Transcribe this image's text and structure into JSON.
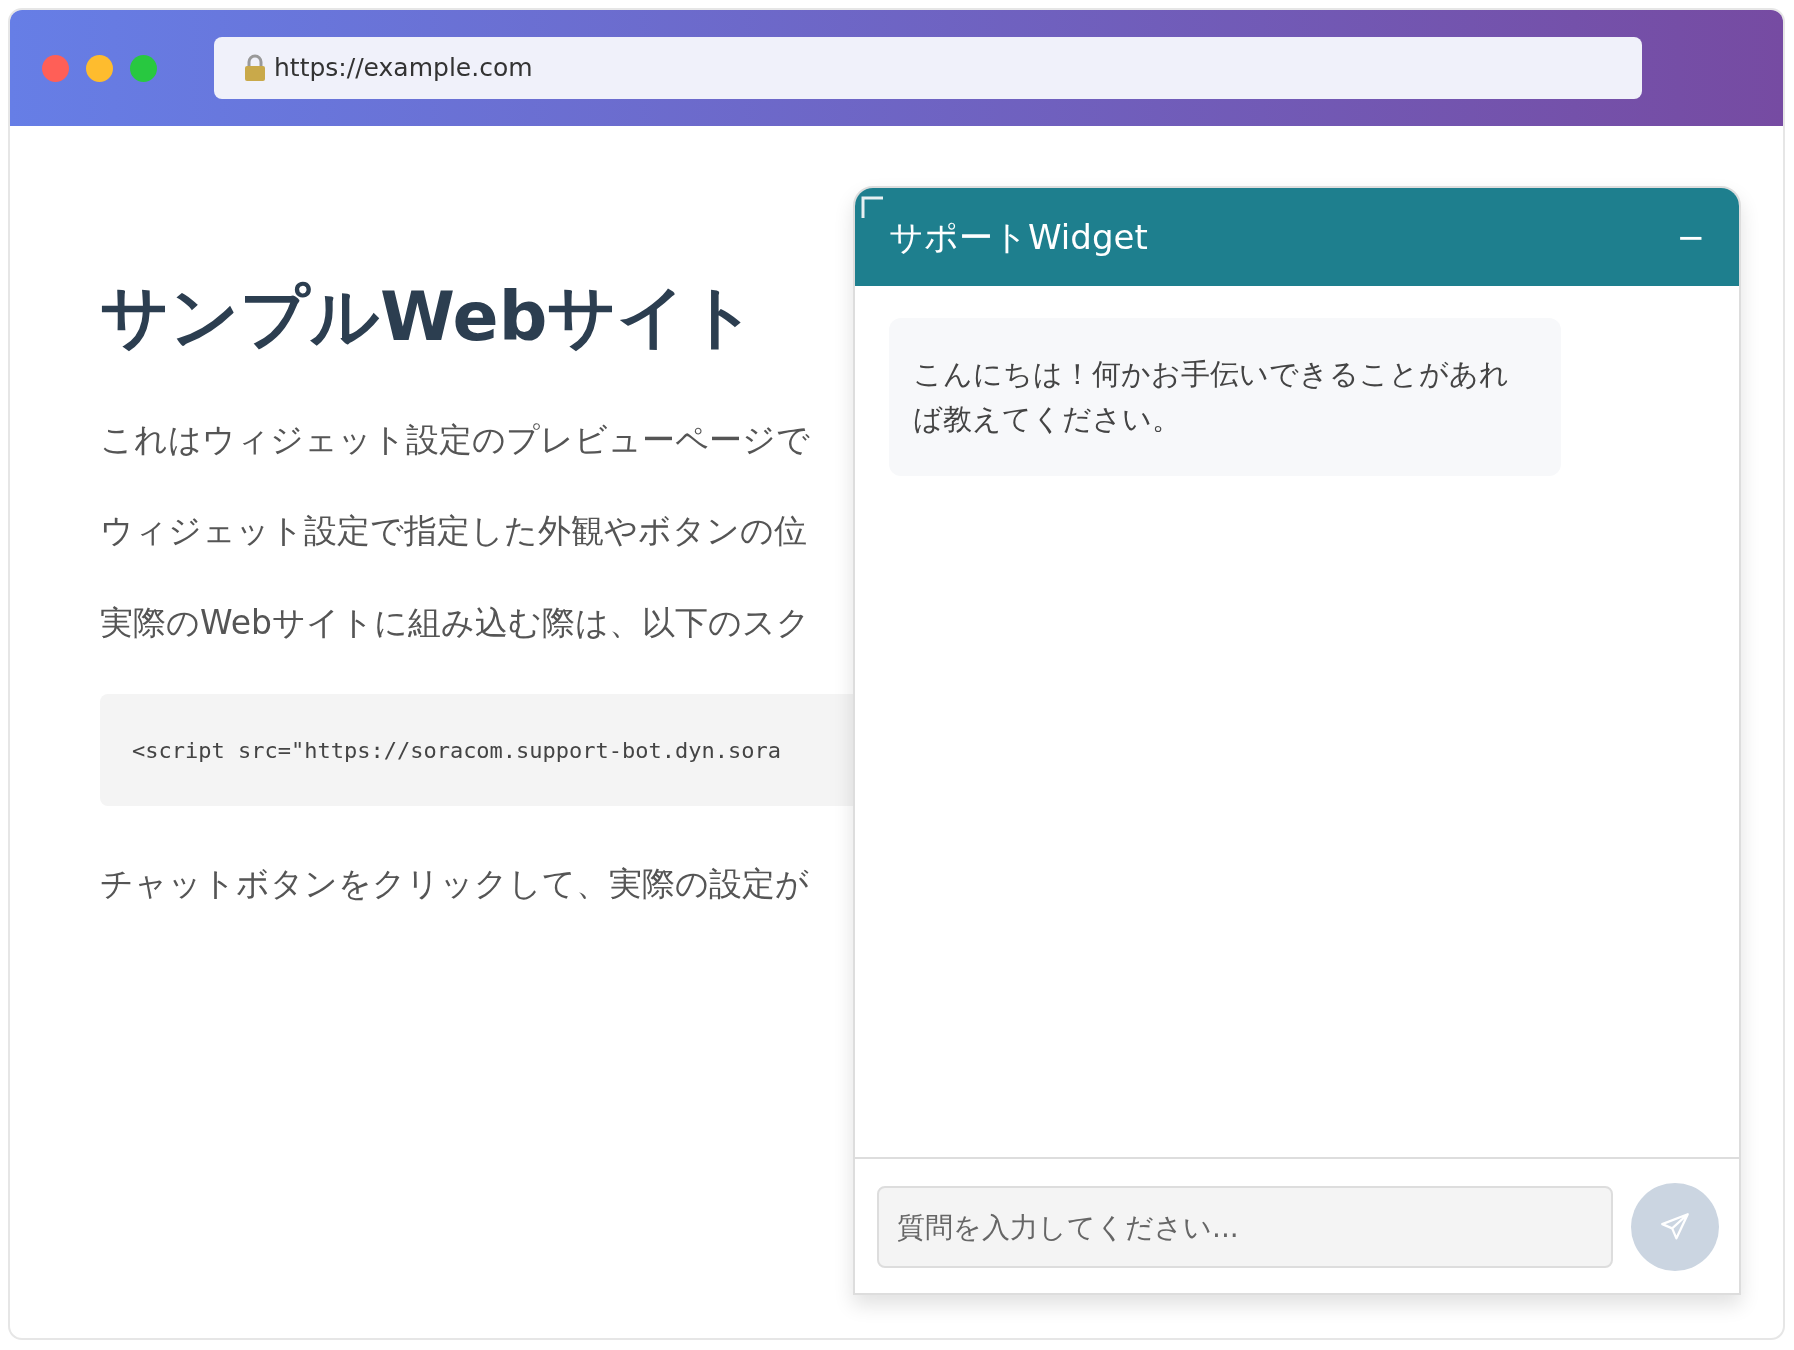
{
  "browser": {
    "url": "https://example.com"
  },
  "page": {
    "heading": "サンプルWebサイト",
    "content": [
      {
        "kind": "paragraph",
        "text": "これはウィジェット設定のプレビューページで"
      },
      {
        "kind": "paragraph",
        "text": "ウィジェット設定で指定した外観やボタンの位"
      },
      {
        "kind": "paragraph",
        "text": "実際のWebサイトに組み込む際は、以下のスク"
      },
      {
        "kind": "code",
        "text": "<script src=\"https://soracom.support-bot.dyn.sora"
      },
      {
        "kind": "paragraph",
        "text": "チャットボタンをクリックして、実際の設定が"
      }
    ]
  },
  "widget": {
    "title": "サポートWidget",
    "minimize": "−",
    "messages": [
      {
        "kind": "bot",
        "text": "こんにちは！何かお手伝いできることがあれば教えてください。"
      }
    ],
    "input": {
      "placeholder": "質問を入力してください..."
    },
    "send_button": {
      "disabled": true
    }
  }
}
